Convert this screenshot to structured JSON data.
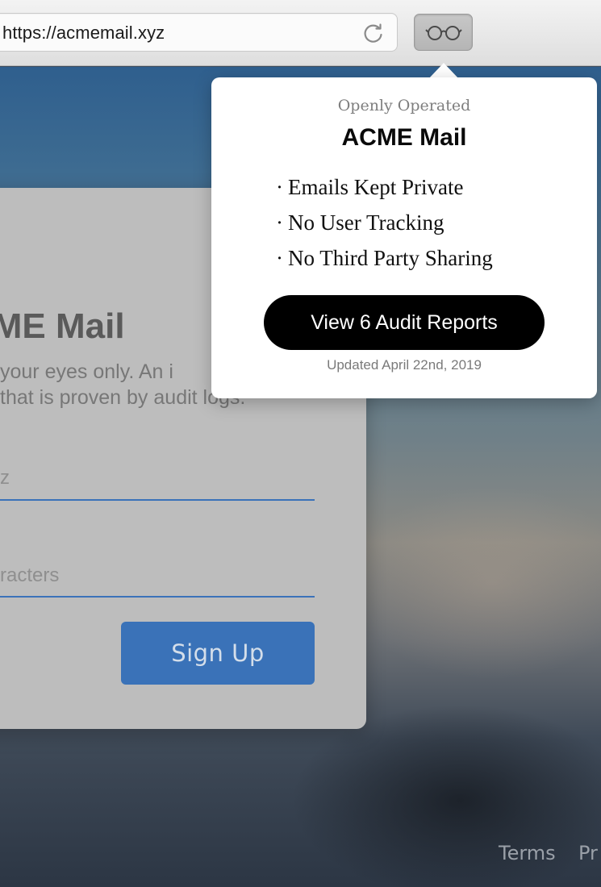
{
  "browser": {
    "url": "https://acmemail.xyz",
    "reload_icon": "reload-icon",
    "extension_icon": "glasses-icon"
  },
  "card": {
    "title": "CME Mail",
    "subtitle_line1": "your eyes only. An i",
    "subtitle_line2": "that is proven by audit logs.",
    "email_field_value": "z",
    "password_field_value": "racters",
    "signup_label": "Sign Up"
  },
  "footer": {
    "terms_label": "Terms",
    "privacy_label": "Pr"
  },
  "popover": {
    "kicker": "Openly Operated",
    "title": "ACME Mail",
    "bullet_symbol": "·",
    "items": [
      "Emails Kept Private",
      "No User Tracking",
      "No Third Party Sharing"
    ],
    "button_label": "View 6 Audit Reports",
    "updated": "Updated April 22nd, 2019"
  },
  "colors": {
    "accent_blue": "#3a72b8",
    "popover_button": "#000000",
    "card_bg": "#bdbdbd"
  }
}
